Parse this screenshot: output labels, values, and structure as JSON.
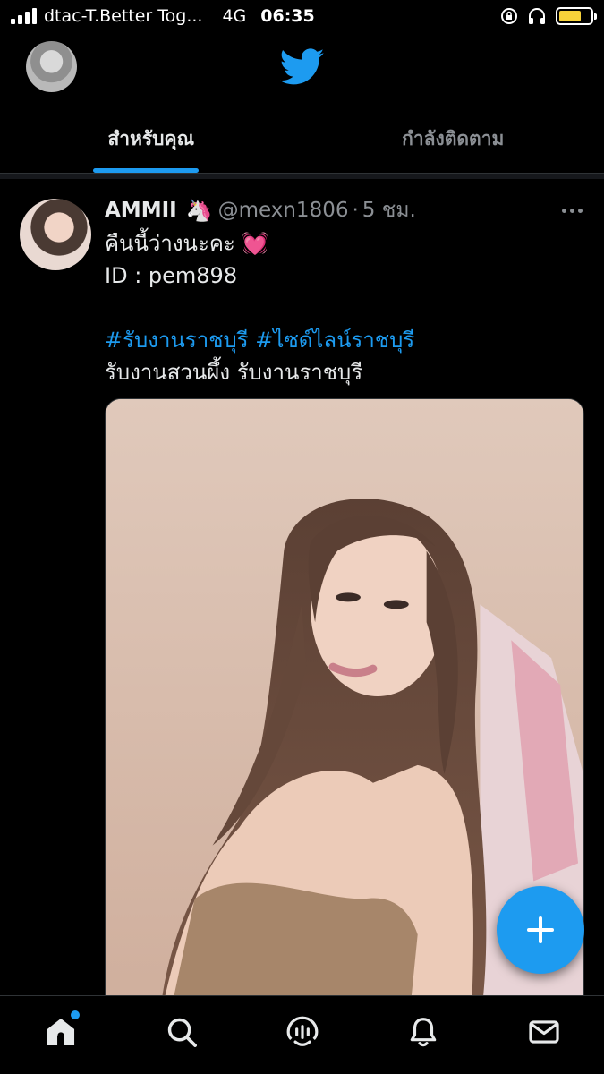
{
  "status_bar": {
    "carrier": "dtac-T.Better Tog...",
    "network": "4G",
    "time": "06:35",
    "battery_level": 0.7,
    "battery_color": "#f7d23a"
  },
  "header": {
    "logo_icon": "twitter-bird-icon",
    "accent_color": "#1d9bf0"
  },
  "tabs": [
    {
      "label": "สำหรับคุณ",
      "active": true
    },
    {
      "label": "กำลังติดตาม",
      "active": false
    }
  ],
  "tweet": {
    "name": "AMMII",
    "name_emoji": "🦄",
    "handle": "@mexn1806",
    "separator": "·",
    "time_ago": "5 ชม.",
    "lines": [
      {
        "text": "คืนนี้ว่างนะคะ",
        "emoji": "💓"
      },
      {
        "text": "ID : pem898"
      },
      {
        "text": ""
      },
      {
        "hashtag1": "#รับงานราชบุรี",
        "hashtag2": "#ไซด์ไลน์ราชบุรี"
      },
      {
        "text": "รับงานสวนผึ้ง รับงานราชบุรี"
      }
    ]
  },
  "bottom_nav": {
    "items": [
      "home-icon",
      "search-icon",
      "spaces-icon",
      "notifications-icon",
      "messages-icon"
    ],
    "home_has_indicator": true
  }
}
